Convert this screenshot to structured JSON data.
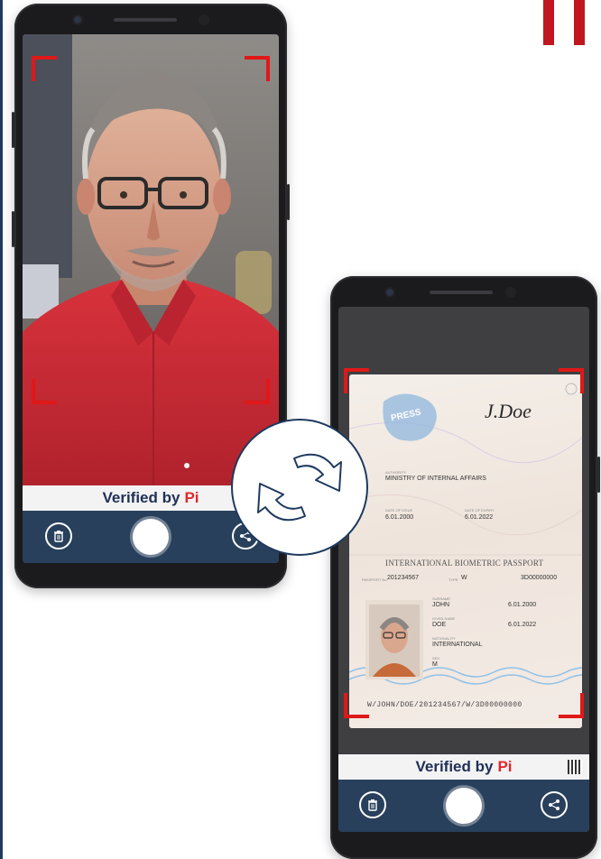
{
  "branding": {
    "accent_color": "#c0161f",
    "navy_color": "#1e3a5f",
    "frame_color": "#e01818"
  },
  "selfie_phone": {
    "verified_text": "Verified by",
    "verified_brand": "Pi",
    "left_button_icon": "trash-icon",
    "right_button_icon": "share-icon"
  },
  "passport_phone": {
    "verified_text": "Verified by",
    "verified_brand": "Pi",
    "left_button_icon": "trash-icon",
    "right_button_icon": "share-icon",
    "passport": {
      "authority_label": "AUTHORITY",
      "authority": "MINISTRY OF INTERNAL AFFAIRS",
      "issue_label": "DATE OF ISSUE",
      "issue_date": "6.01.2000",
      "expiry_label": "DATE OF EXPIRY",
      "expiry_date": "6.01.2022",
      "title": "INTERNATIONAL BIOMETRIC PASSPORT",
      "passport_no_label": "PASSPORT No.",
      "passport_no": "201234567",
      "type_label": "TYPE",
      "type": "W",
      "serial": "3D00000000",
      "surname_label": "SURNAME",
      "surname": "JOHN",
      "given_label": "GIVEN NAME",
      "given_name": "DOE",
      "nationality_label": "NATIONALITY",
      "nationality": "INTERNATIONAL",
      "sex_label": "SEX",
      "sex": "M",
      "issue_date_2": "6.01.2000",
      "expiry_date_2": "6.01.2022",
      "signature": "J.Doe",
      "stamp": "PRESS",
      "mrz": "W/JOHN/DOE/201234567/W/3D00000000"
    }
  },
  "sync_icon": "sync-arrows-icon"
}
